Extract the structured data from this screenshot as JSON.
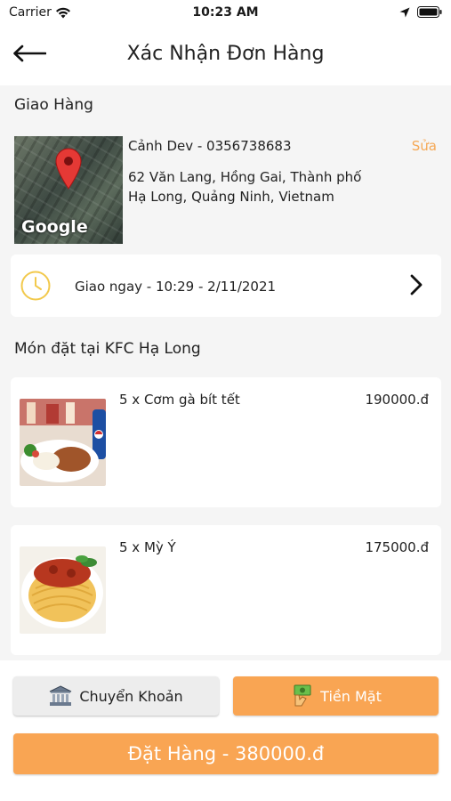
{
  "status_bar": {
    "carrier": "Carrier",
    "time": "10:23 AM"
  },
  "header": {
    "title": "Xác Nhận Đơn Hàng",
    "back_icon": "arrow-left-icon"
  },
  "delivery": {
    "section_label": "Giao Hàng",
    "map_label": "Google",
    "contact": "Cảnh Dev - 0356738683",
    "edit_label": "Sửa",
    "address": "62 Văn Lang, Hồng Gai, Thành phố Hạ Long, Quảng Ninh, Vietnam",
    "time_text": "Giao ngay - 10:29 - 2/11/2021"
  },
  "order": {
    "section_label": "Món đặt tại KFC Hạ Long",
    "items": [
      {
        "name": "5 x Cơm gà bít tết",
        "price": "190000.đ"
      },
      {
        "name": "5 x Mỳ Ý",
        "price": "175000.đ"
      }
    ]
  },
  "payment": {
    "bank_label": "Chuyển Khoản",
    "cash_label": "Tiền Mặt",
    "selected": "cash"
  },
  "submit": {
    "label": "Đặt Hàng - 380000.đ"
  },
  "colors": {
    "accent": "#f9a553",
    "edit": "#f5a855",
    "clock": "#f2c94c"
  }
}
